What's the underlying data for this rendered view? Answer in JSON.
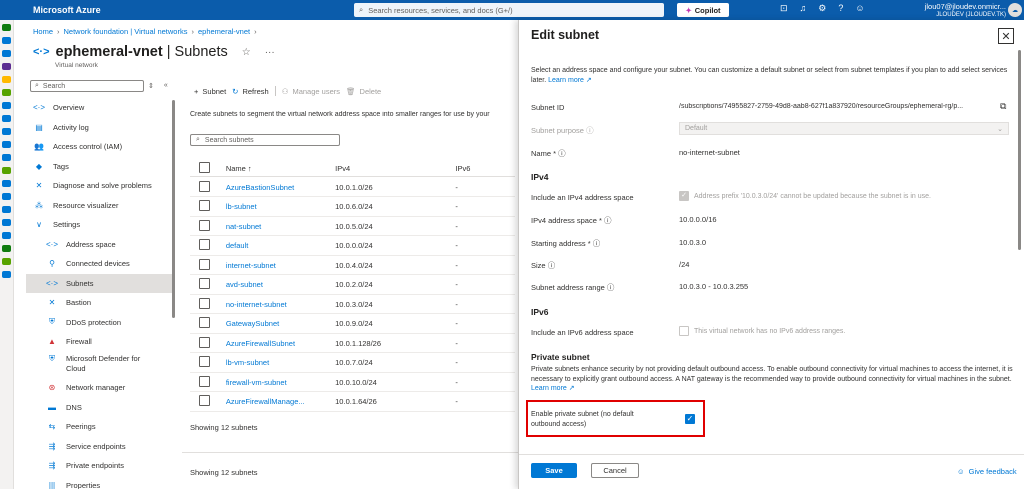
{
  "topbar": {
    "brand": "Microsoft Azure",
    "search_placeholder": "Search resources, services, and docs (G+/)",
    "copilot": "Copilot",
    "user_name": "jlou07@jloudev.onmicr...",
    "user_tenant": "JLOUDEV (JLOUDEV.TK)"
  },
  "breadcrumb": {
    "items": [
      "Home",
      "Network foundation | Virtual networks",
      "ephemeral-vnet"
    ]
  },
  "page": {
    "resource": "ephemeral-vnet",
    "section": "Subnets",
    "subtitle": "Virtual network"
  },
  "nav": {
    "search_placeholder": "Search",
    "items": [
      {
        "label": "Overview",
        "icon": "<·>",
        "sub": false
      },
      {
        "label": "Activity log",
        "icon": "▤",
        "sub": false
      },
      {
        "label": "Access control (IAM)",
        "icon": "👥",
        "sub": false
      },
      {
        "label": "Tags",
        "icon": "◆",
        "sub": false
      },
      {
        "label": "Diagnose and solve problems",
        "icon": "✕",
        "sub": false
      },
      {
        "label": "Resource visualizer",
        "icon": "⁂",
        "sub": false
      },
      {
        "label": "Settings",
        "icon": "∨",
        "sub": false
      },
      {
        "label": "Address space",
        "icon": "<·>",
        "sub": true
      },
      {
        "label": "Connected devices",
        "icon": "⚲",
        "sub": true
      },
      {
        "label": "Subnets",
        "icon": "<·>",
        "sub": true
      },
      {
        "label": "Bastion",
        "icon": "✕",
        "sub": true
      },
      {
        "label": "DDoS protection",
        "icon": "⛨",
        "sub": true
      },
      {
        "label": "Firewall",
        "icon": "▲",
        "sub": true
      },
      {
        "label": "Microsoft Defender for",
        "icon": "⛨",
        "sub": true
      },
      {
        "label": "Network manager",
        "icon": "⊛",
        "sub": true
      },
      {
        "label": "DNS",
        "icon": "▬",
        "sub": true
      },
      {
        "label": "Peerings",
        "icon": "⇆",
        "sub": true
      },
      {
        "label": "Service endpoints",
        "icon": "⇶",
        "sub": true
      },
      {
        "label": "Private endpoints",
        "icon": "⇶",
        "sub": true
      },
      {
        "label": "Properties",
        "icon": "|||",
        "sub": true
      }
    ],
    "defender_line2": "Cloud"
  },
  "toolbar": {
    "subnet": "Subnet",
    "refresh": "Refresh",
    "manage_users": "Manage users",
    "delete": "Delete"
  },
  "content": {
    "description": "Create subnets to segment the virtual network address space into smaller ranges for use by your",
    "search_placeholder": "Search subnets",
    "columns": [
      "Name ↑",
      "IPv4",
      "IPv6"
    ],
    "rows": [
      [
        "AzureBastionSubnet",
        "10.0.1.0/26",
        "-"
      ],
      [
        "lb-subnet",
        "10.0.6.0/24",
        "-"
      ],
      [
        "nat-subnet",
        "10.0.5.0/24",
        "-"
      ],
      [
        "default",
        "10.0.0.0/24",
        "-"
      ],
      [
        "internet-subnet",
        "10.0.4.0/24",
        "-"
      ],
      [
        "avd-subnet",
        "10.0.2.0/24",
        "-"
      ],
      [
        "no-internet-subnet",
        "10.0.3.0/24",
        "-"
      ],
      [
        "GatewaySubnet",
        "10.0.9.0/24",
        "-"
      ],
      [
        "AzureFirewallSubnet",
        "10.0.1.128/26",
        "-"
      ],
      [
        "lb-vm-subnet",
        "10.0.7.0/24",
        "-"
      ],
      [
        "firewall-vm-subnet",
        "10.0.10.0/24",
        "-"
      ],
      [
        "AzureFirewallManage...",
        "10.0.1.64/26",
        "-"
      ]
    ],
    "footer1": "Showing 12 subnets",
    "footer2": "Showing 12 subnets"
  },
  "panel": {
    "title": "Edit subnet",
    "description": "Select an address space and configure your subnet. You can customize a default subnet or select from subnet templates if you plan to add select services later.",
    "learn_more": "Learn more",
    "subnet_id_label": "Subnet ID",
    "subnet_id": "/subscriptions/74955827-2759-49d8-aab8-627f1a837920/resourceGroups/ephemeral-rg/p...",
    "purpose_label": "Subnet purpose",
    "purpose_value": "Default",
    "name_label": "Name *",
    "name_value": "no-internet-subnet",
    "ipv4_heading": "IPv4",
    "include_ipv4_label": "Include an IPv4 address space",
    "include_ipv4_note": "Address prefix '10.0.3.0/24' cannot be updated because the subnet is in use.",
    "ipv4_space_label": "IPv4 address space *",
    "ipv4_space_value": "10.0.0.0/16",
    "start_label": "Starting address *",
    "start_value": "10.0.3.0",
    "size_label": "Size",
    "size_value": "/24",
    "range_label": "Subnet address range",
    "range_value": "10.0.3.0 - 10.0.3.255",
    "ipv6_heading": "IPv6",
    "include_ipv6_label": "Include an IPv6 address space",
    "include_ipv6_note": "This virtual network has no IPv6 address ranges.",
    "private_heading": "Private subnet",
    "private_desc": "Private subnets enhance security by not providing default outbound access. To enable outbound connectivity for virtual machines to access the internet, it is necessary to explicitly grant outbound access. A NAT gateway is the recommended way to provide outbound connectivity for virtual machines in the subnet.",
    "private_learn": "Learn more",
    "enable_private_l1": "Enable private subnet (no default",
    "enable_private_l2": "outbound access)",
    "save": "Save",
    "cancel": "Cancel",
    "feedback": "Give feedback"
  }
}
